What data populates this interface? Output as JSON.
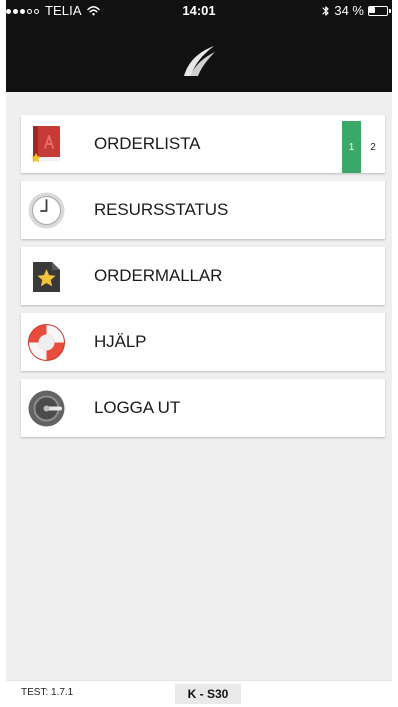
{
  "status_bar": {
    "signal_filled": 3,
    "signal_total": 5,
    "carrier": "TELIA",
    "time": "14:01",
    "battery": "34 %",
    "battery_level": 0.34
  },
  "header": {
    "logo_icon": "app-logo-icon"
  },
  "menu": {
    "items": [
      {
        "id": "orderlista",
        "label": "ORDERLISTA",
        "icon": "book-icon",
        "badges": {
          "green": "1",
          "white": "2"
        }
      },
      {
        "id": "resursstatus",
        "label": "RESURSSTATUS",
        "icon": "clock-icon"
      },
      {
        "id": "ordermallar",
        "label": "ORDERMALLAR",
        "icon": "starred-folder-icon"
      },
      {
        "id": "hjalp",
        "label": "HJÄLP",
        "icon": "lifebuoy-icon"
      },
      {
        "id": "logga-ut",
        "label": "LOGGA UT",
        "icon": "power-dial-icon"
      }
    ]
  },
  "footer": {
    "version": "TEST: 1.7.1",
    "vehicle": "K - S30"
  },
  "colors": {
    "background": "#efefef",
    "header": "#111111",
    "card": "#ffffff",
    "accent_green": "#3aa866",
    "text": "#1b1b1b"
  }
}
